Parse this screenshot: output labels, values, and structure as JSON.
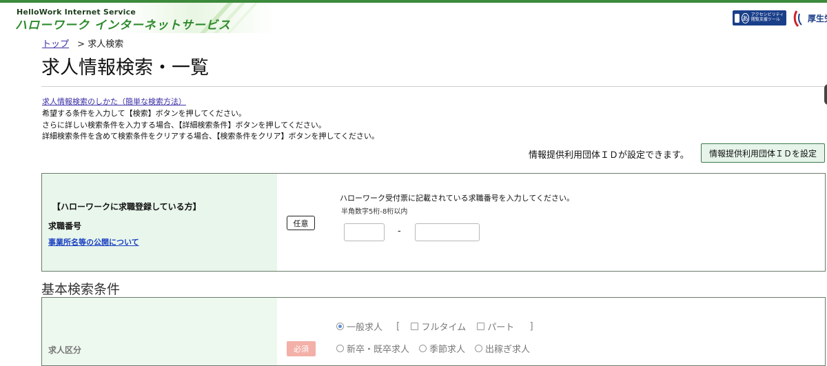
{
  "header": {
    "brand_en": "HelloWork Internet Service",
    "brand_jp": "ハローワーク インターネットサービス",
    "accessibility_label": "アクセシビリティ 閲覧支援ツール",
    "accessibility_glyph": "あ",
    "ministry_label": "厚生労"
  },
  "breadcrumb": {
    "top": "トップ",
    "separator": ">",
    "current": "求人検索"
  },
  "page_title": "求人情報検索・一覧",
  "instructions": {
    "howto_link": "求人情報検索のしかた（簡単な検索方法）",
    "line1": "希望する条件を入力して【検索】ボタンを押してください。",
    "line2": "さらに詳しい検索条件を入力する場合、【詳細検索条件】ボタンを押してください。",
    "line3": "詳細検索条件を含めて検索条件をクリアする場合、【検索条件をクリア】ボタンを押してください。"
  },
  "info_id": {
    "label": "情報提供利用団体ＩＤが設定できます。",
    "button": "情報提供利用団体ＩＤを設定"
  },
  "job_seeker": {
    "heading": "【ハローワークに求職登録している方】",
    "label": "求職番号",
    "link": "事業所名等の公開について",
    "badge": "任意",
    "description": "ハローワーク受付票に記載されている求職番号を入力してください。",
    "hint": "半角数字5桁-8桁以内",
    "input1_value": "",
    "input2_value": "",
    "dash": "-"
  },
  "basic_search": {
    "title": "基本検索条件",
    "label": "求人区分",
    "required_badge": "必須",
    "radio_general": "一般求人",
    "bracket_open": "[",
    "bracket_close": "]",
    "check_fulltime": "フルタイム",
    "check_parttime": "パート",
    "radio_newgrad": "新卒・既卒求人",
    "radio_seasonal": "季節求人",
    "radio_migrant": "出稼ぎ求人"
  },
  "colors": {
    "brand_green": "#2d8a2d",
    "panel_green": "#e8f6ec",
    "link_blue": "#3a2ea6",
    "required_red": "#f3b0a8"
  }
}
